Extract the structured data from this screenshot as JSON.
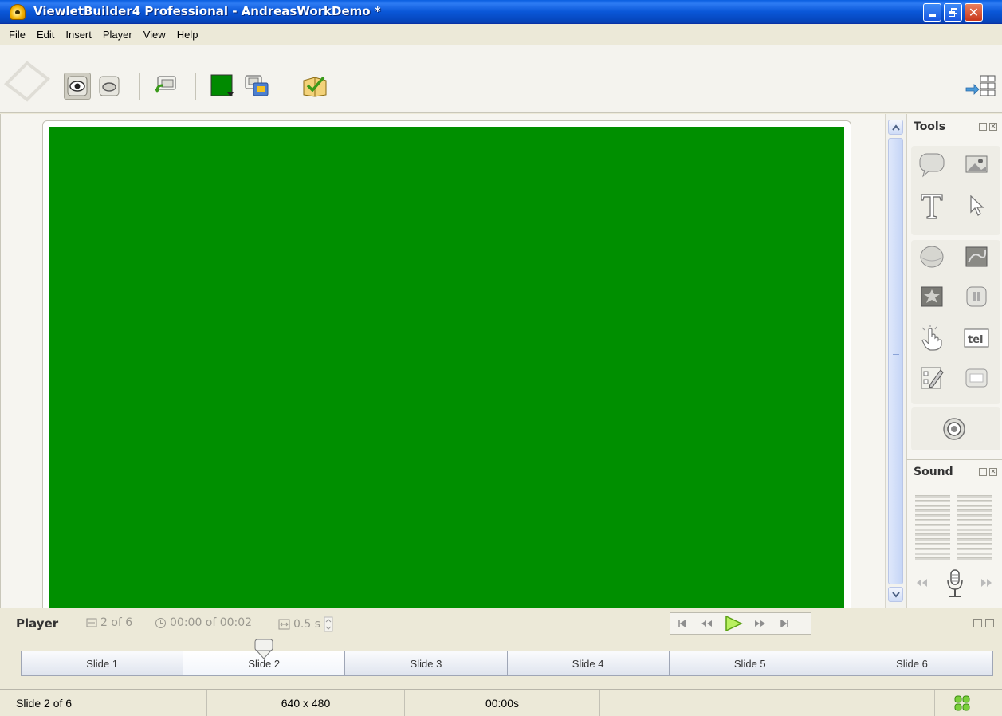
{
  "window": {
    "title": "ViewletBuilder4 Professional - AndreasWorkDemo *"
  },
  "menu": {
    "items": [
      "File",
      "Edit",
      "Insert",
      "Player",
      "View",
      "Help"
    ]
  },
  "toolbar": {
    "buttons": [
      {
        "icon": "eye-icon",
        "active": true
      },
      {
        "icon": "lens-icon",
        "active": false
      },
      {
        "icon": "import-slide-icon",
        "active": false
      },
      {
        "icon": "background-color-icon",
        "active": false
      },
      {
        "icon": "copy-slide-icon",
        "active": false
      },
      {
        "icon": "publish-icon",
        "active": false
      }
    ],
    "layout_icon": "layout-switch-icon",
    "background_color": "#008a00"
  },
  "canvas": {
    "slide_color": "#008f00"
  },
  "tools_panel": {
    "title": "Tools",
    "tools": [
      "callout-icon",
      "image-icon",
      "text-icon",
      "cursor-icon",
      "shape-icon",
      "picture-icon",
      "flash-icon",
      "pause-icon",
      "hand-click-icon",
      "text-field-icon",
      "quiz-icon",
      "dialog-icon",
      "record-icon"
    ]
  },
  "sound_panel": {
    "title": "Sound",
    "icons": [
      "rewind-icon",
      "microphone-icon",
      "fast-forward-icon"
    ]
  },
  "player": {
    "title": "Player",
    "slide_counter": "2 of 6",
    "time": "00:00 of 00:02",
    "transition": "0.5 s",
    "controls": [
      "first-icon",
      "rewind-icon",
      "play-icon",
      "fast-forward-icon",
      "last-icon"
    ]
  },
  "timeline": {
    "slides": [
      "Slide 1",
      "Slide 2",
      "Slide 3",
      "Slide 4",
      "Slide 5",
      "Slide 6"
    ],
    "current_index": 1
  },
  "status": {
    "slide": "Slide 2 of 6",
    "size": "640 x 480",
    "time": "00:00s"
  }
}
